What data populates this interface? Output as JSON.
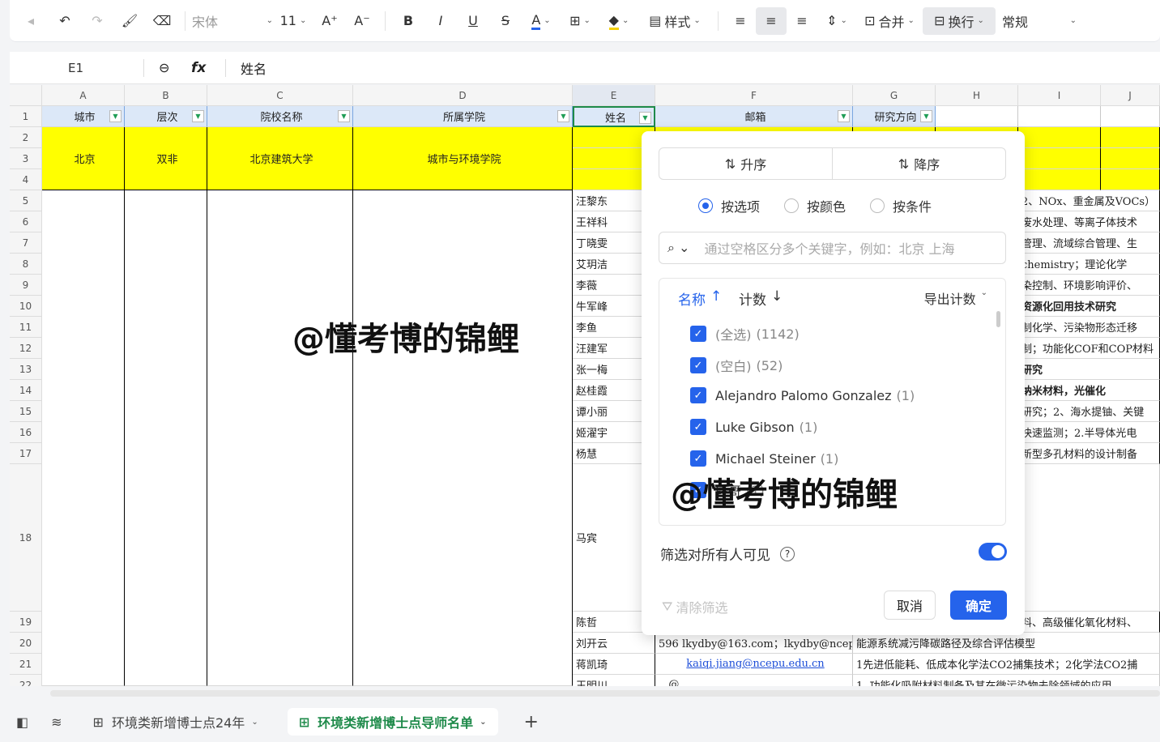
{
  "toolbar": {
    "font": "宋体",
    "size": "11",
    "style": "样式",
    "merge": "合并",
    "wrap": "换行",
    "format": "常规"
  },
  "formula_bar": {
    "cell_ref": "E1",
    "fx": "fx",
    "value": "姓名"
  },
  "columns": [
    "A",
    "B",
    "C",
    "D",
    "E",
    "F",
    "G",
    "H",
    "I",
    "J"
  ],
  "header_row": {
    "A": "城市",
    "B": "层次",
    "C": "院校名称",
    "D": "所属学院",
    "E": "姓名",
    "F": "邮箱",
    "G": "研究方向"
  },
  "merged": {
    "city": "北京",
    "level": "双非",
    "school": "北京建筑大学",
    "college": "城市与环境学院"
  },
  "rows": [
    "1",
    "2",
    "3",
    "4",
    "5",
    "6",
    "7",
    "8",
    "9",
    "10",
    "11",
    "12",
    "13",
    "14",
    "15",
    "16",
    "17",
    "18",
    "19",
    "20",
    "21",
    "22"
  ],
  "names": [
    "汪黎东",
    "王祥科",
    "丁晓雯",
    "艾玥洁",
    "李薇",
    "牛军峰",
    "李鱼",
    "汪建军",
    "张一梅",
    "赵桂霞",
    "谭小丽",
    "姬濯宇",
    "杨慧",
    "马宾",
    "陈哲",
    "刘开云",
    "蒋凯琦",
    "王明川"
  ],
  "research": [
    "2、NOx、重金属及VOCs）",
    "废水处理、等离子体技术",
    "管理、流域综合管理、生",
    "chemistry；理论化学",
    "染控制、环境影响评价、",
    "资源化回用技术研究",
    "制化学、污染物形态迁移",
    "制；功能化COF和COP材料",
    "研究",
    "纳米材料，光催化",
    "研究；2、海水提铀、关键",
    "快速监测；2.半导体光电",
    "新型多孔材料的设计制备",
    "料、高级催化氧化材料、"
  ],
  "row20": {
    "email": "596 lkydby@163.com；lkydby@ncep",
    "research": "能源系统减污降碳路径及综合评估模型"
  },
  "row21": {
    "email": "kaiqi.jiang@ncepu.edu.cn",
    "research": "1先进低能耗、低成本化学法CO2捕集技术；2化学法CO2捕"
  },
  "row22": {
    "email": "...@...",
    "research": "1. 功能化吸附材料制备及其在微污染物去除领域的应用"
  },
  "filter_panel": {
    "sort_asc": "升序",
    "sort_desc": "降序",
    "modes": [
      "按选项",
      "按颜色",
      "按条件"
    ],
    "search_placeholder": "通过空格区分多个关键字，例如：北京 上海",
    "list_name": "名称",
    "list_count": "计数",
    "export": "导出计数",
    "items": [
      {
        "label": "(全选)",
        "count": "(1142)"
      },
      {
        "label": "(空白)",
        "count": "(52)"
      },
      {
        "label": "Alejandro Palomo Gonzalez",
        "count": "(1)"
      },
      {
        "label": "Luke Gibson",
        "count": "(1)"
      },
      {
        "label": "Michael Steiner",
        "count": "(1)"
      },
      {
        "label": "段哥",
        "count": "(1)"
      }
    ],
    "visible_label": "筛选对所有人可见",
    "clear": "清除筛选",
    "cancel": "取消",
    "confirm": "确定"
  },
  "watermark": "@懂考博的锦鲤",
  "sheets": [
    "环境类新增博士点24年",
    "环境类新增博士点导师名单"
  ],
  "colors": {
    "accent": "#2563eb",
    "header_fill": "#dce8f8",
    "yellow": "#ffff00",
    "sheet_active": "#1e8a4a"
  }
}
